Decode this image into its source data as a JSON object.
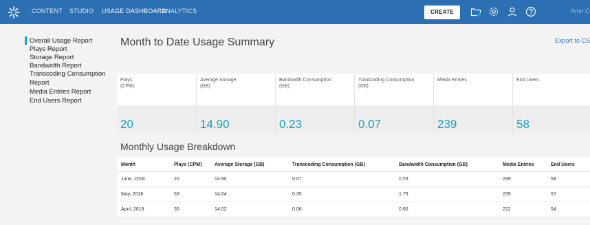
{
  "nav": {
    "items": [
      "CONTENT",
      "STUDIO",
      "USAGE DASHBOARD",
      "ANALYTICS"
    ],
    "active": "USAGE DASHBOARD",
    "create_label": "CREATE",
    "user_name": "Amir Chervinsky",
    "icons": [
      "upload-folder-icon",
      "settings-gear-icon",
      "user-icon",
      "help-icon"
    ]
  },
  "sidebar": {
    "items": [
      "Overall Usage Report",
      "Plays Report",
      "Storage Report",
      "Bandwidth Report",
      "Transcoding Consumption",
      "Report",
      "Media Entries Report",
      "End Users Report"
    ]
  },
  "summary": {
    "title": "Month to Date Usage Summary",
    "export_label": "Export to CSV",
    "cards": [
      {
        "label": "Plays\n(CPM)",
        "value": "20"
      },
      {
        "label": "Average Storage\n(GB)",
        "value": "14.90"
      },
      {
        "label": "Bandwidth Consumption\n(GB)",
        "value": "0.23"
      },
      {
        "label": "Transcoding Consumption\n(GB)",
        "value": "0.07"
      },
      {
        "label": "Media Entries",
        "value": "239"
      },
      {
        "label": "End Users",
        "value": "58"
      }
    ]
  },
  "breakdown": {
    "title": "Monthly Usage Breakdown",
    "columns": [
      "Month",
      "Plays (CPM)",
      "Average Storage (GB)",
      "Transcoding Consumption (GB)",
      "Bandwidth Consumption (GB)",
      "Media Entries",
      "End Users"
    ],
    "rows": [
      [
        "June, 2018",
        "20",
        "14.90",
        "0.07",
        "0.23",
        "239",
        "58"
      ],
      [
        "May, 2018",
        "53",
        "14.64",
        "0.35",
        "1.79",
        "239",
        "57"
      ],
      [
        "April, 2018",
        "35",
        "14.02",
        "0.06",
        "0.66",
        "222",
        "54"
      ]
    ]
  },
  "colors": {
    "nav_bg": "#2c6fb3",
    "accent": "#1aa0d9",
    "value_text": "#1aa0b8",
    "link": "#1f77c8"
  }
}
